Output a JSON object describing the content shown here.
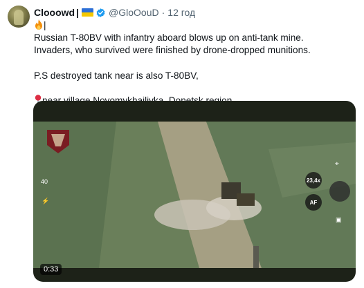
{
  "tweet": {
    "author_name": "Clooowd",
    "separator": "|",
    "handle": "@GloOouD",
    "dot": "·",
    "time": "12 год",
    "line1": "Russian T-80BV with infantry aboard blows up on anti-tank mine.",
    "line2": "Invaders, who survived were finished by drone-dropped munitions.",
    "line3": "P.S destroyed tank near is also T-80BV,",
    "line4": "near village Novomykhailivka, Donetsk region",
    "fire_emoji_icon": "fire-icon",
    "pin_icon": "pin-icon"
  },
  "video": {
    "duration": "0:33",
    "overlay_left": "40",
    "overlay_zoom": "23,4x",
    "overlay_af": "AF"
  },
  "colors": {
    "text": "#0f1419",
    "secondary": "#536471",
    "verified": "#1d9bf0"
  }
}
